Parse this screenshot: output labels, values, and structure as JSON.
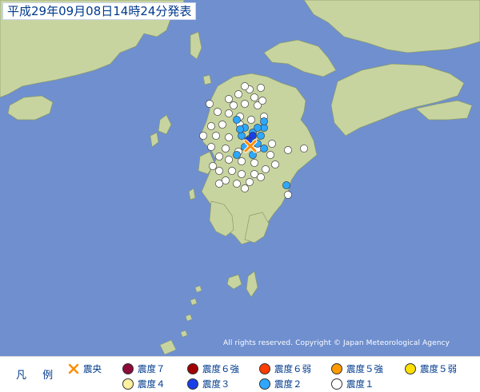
{
  "title": "平成29年09月08日14時24分発表",
  "copyright": "All rights reserved. Copyright © Japan Meteorological Agency",
  "legend": {
    "title": "凡 例",
    "items": [
      {
        "key": "epicenter",
        "label": "震央",
        "icon": "cross-icon",
        "color": "#ff8c00"
      },
      {
        "key": "int7",
        "label": "震度７",
        "color": "#8b0a3a"
      },
      {
        "key": "int6s",
        "label": "震度６強",
        "color": "#a00000"
      },
      {
        "key": "int6w",
        "label": "震度６弱",
        "color": "#ff3c00"
      },
      {
        "key": "int5s",
        "label": "震度５強",
        "color": "#ff9a00"
      },
      {
        "key": "int5w",
        "label": "震度５弱",
        "color": "#ffe000"
      },
      {
        "key": "int4",
        "label": "震度４",
        "color": "#fff0a0"
      },
      {
        "key": "int3",
        "label": "震度３",
        "color": "#1a3ee8"
      },
      {
        "key": "int2",
        "label": "震度２",
        "color": "#2ea8ff"
      },
      {
        "key": "int1",
        "label": "震度１",
        "color": "#ffffff"
      }
    ]
  },
  "colors": {
    "sea": "#6f8fcf",
    "land": "#c8d4a0",
    "land_border": "#8a9a6a",
    "title_text": "#003a8c"
  }
}
